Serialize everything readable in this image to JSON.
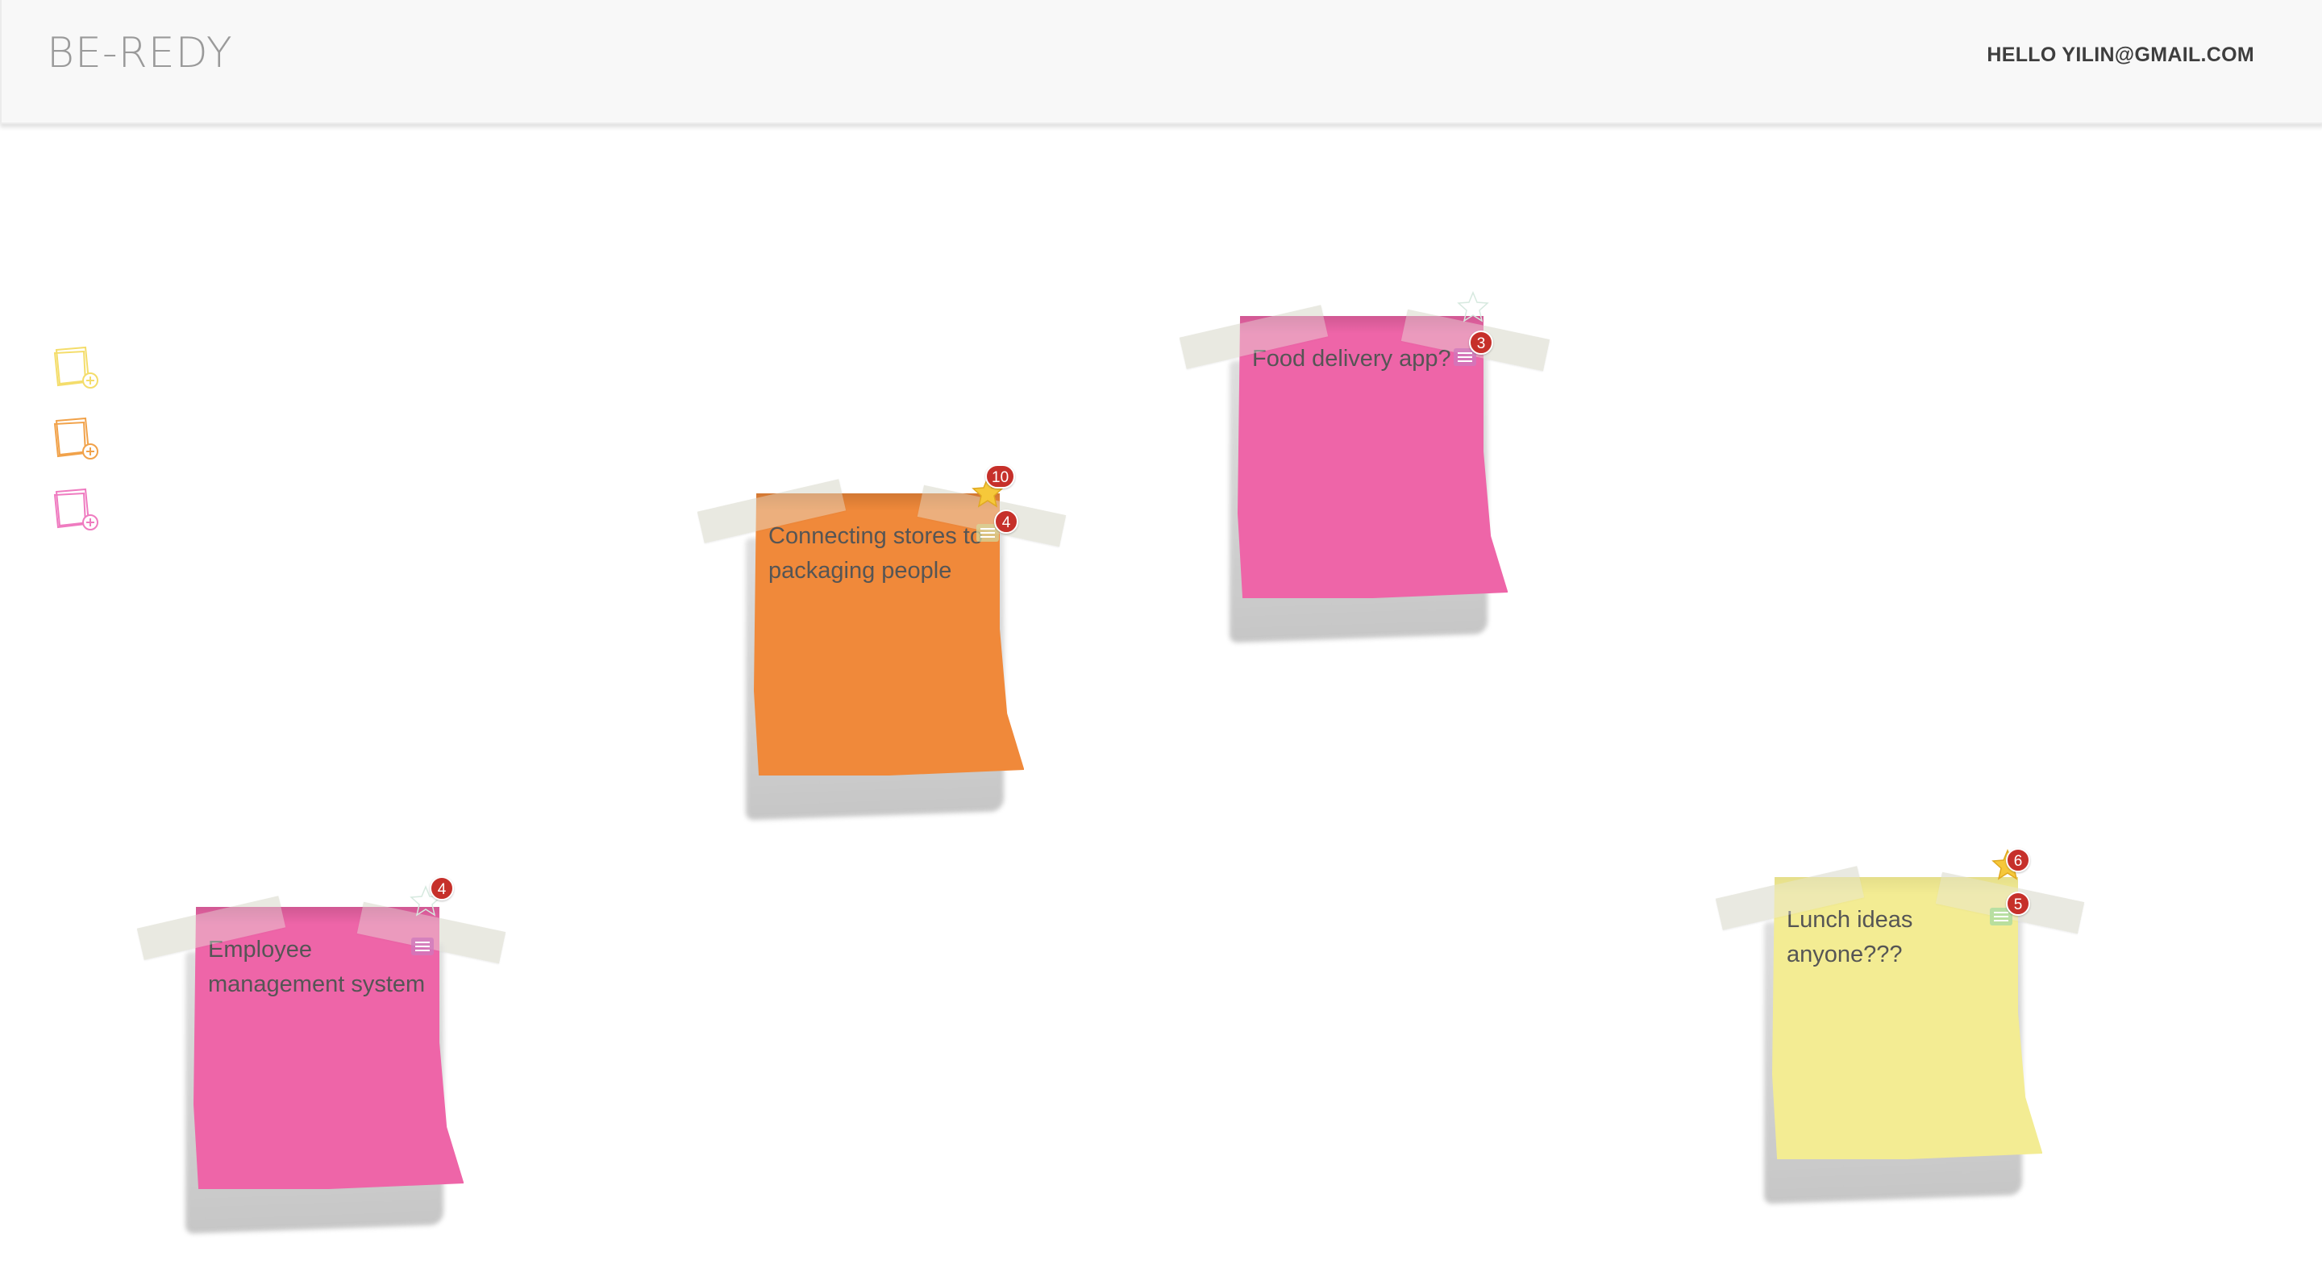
{
  "header": {
    "brand": "BE-REDY",
    "greeting": "HELLO YILIN@GMAIL.COM"
  },
  "toolbar": {
    "add_buttons": [
      {
        "name": "add-yellow-note",
        "color": "#f4dd6b"
      },
      {
        "name": "add-orange-note",
        "color": "#f1a24a"
      },
      {
        "name": "add-pink-note",
        "color": "#ef7bc0"
      }
    ]
  },
  "notes": [
    {
      "title": "Connecting stores to packaging people",
      "color": "#f0893a",
      "stars": "10",
      "comments": "4",
      "starred": true
    },
    {
      "title": "Food delivery app?",
      "color": "#ee65a8",
      "stars": "",
      "comments": "3",
      "starred": false
    },
    {
      "title": "Employee management system",
      "color": "#ee65a8",
      "stars": "4",
      "comments": "",
      "starred": false
    },
    {
      "title": "Lunch ideas anyone???",
      "color": "#f3ec93",
      "stars": "6",
      "comments": "5",
      "starred": true
    }
  ]
}
